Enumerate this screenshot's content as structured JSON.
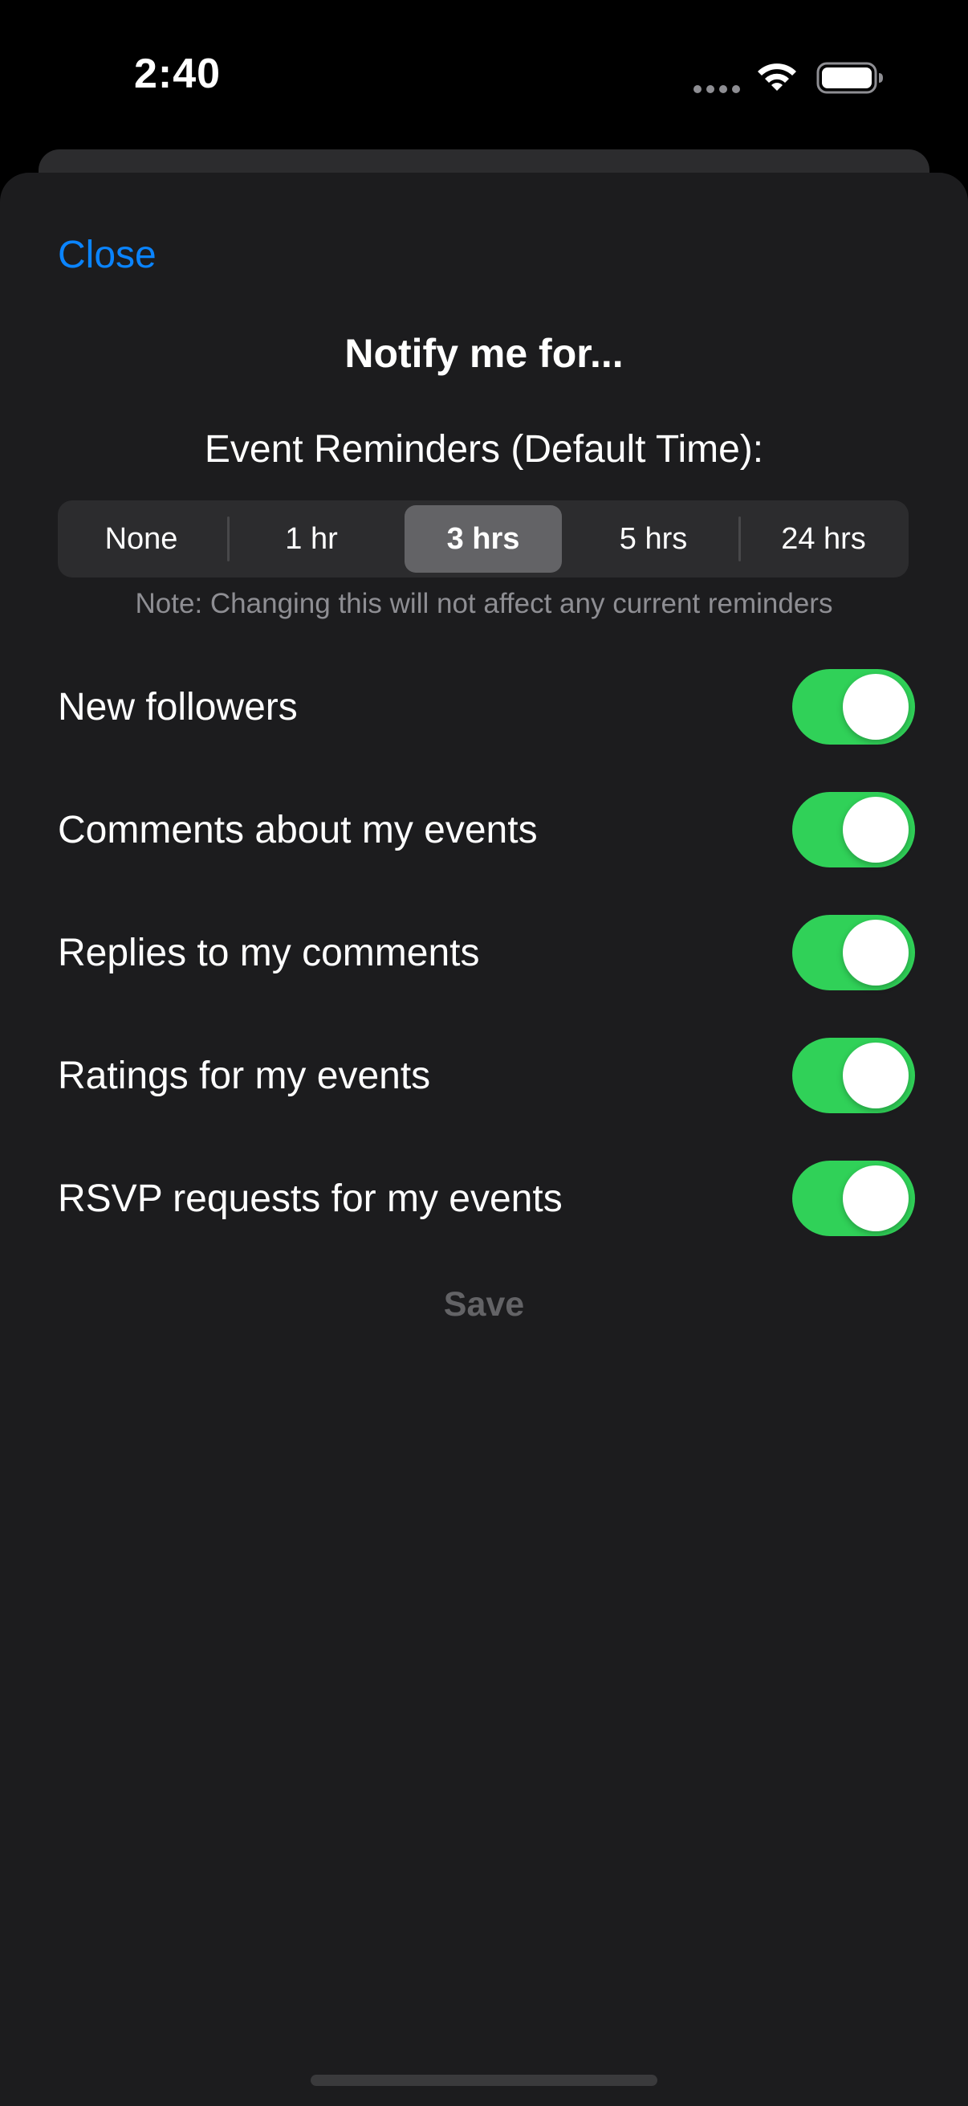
{
  "status_bar": {
    "time": "2:40"
  },
  "header": {
    "close_label": "Close",
    "title": "Notify me for..."
  },
  "reminders": {
    "label": "Event Reminders (Default Time):",
    "options": [
      "None",
      "1 hr",
      "3 hrs",
      "5 hrs",
      "24 hrs"
    ],
    "selected": "3 hrs",
    "note": "Note: Changing this will not affect any current reminders"
  },
  "toggles": [
    {
      "label": "New followers",
      "on": true
    },
    {
      "label": "Comments about my events",
      "on": true
    },
    {
      "label": "Replies to my comments",
      "on": true
    },
    {
      "label": "Ratings for my events",
      "on": true
    },
    {
      "label": "RSVP requests for my events",
      "on": true
    }
  ],
  "footer": {
    "save_label": "Save"
  },
  "colors": {
    "accent": "#0a84ff",
    "toggle_on": "#30d158",
    "sheet_background": "#1c1c1e",
    "disabled_text": "#636366"
  },
  "icons": {
    "cellular": "cellular-signal-icon",
    "wifi": "wifi-icon",
    "battery": "battery-icon"
  }
}
